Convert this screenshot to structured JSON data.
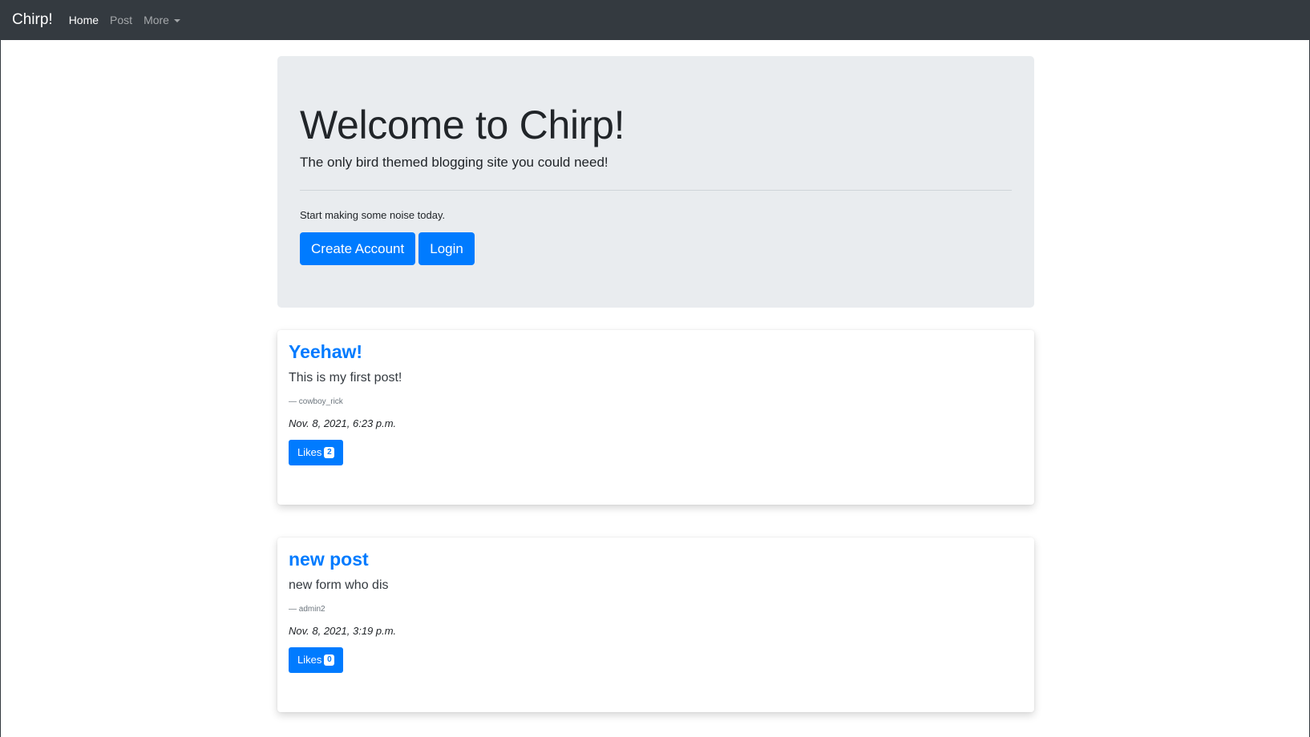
{
  "navbar": {
    "brand": "Chirp!",
    "links": [
      {
        "label": "Home",
        "active": true
      },
      {
        "label": "Post",
        "active": false
      },
      {
        "label": "More",
        "active": false,
        "dropdown": true
      }
    ]
  },
  "hero": {
    "title": "Welcome to Chirp!",
    "lead": "The only bird themed blogging site you could need!",
    "text": "Start making some noise today.",
    "create_account_label": "Create Account",
    "login_label": "Login"
  },
  "posts": [
    {
      "title": "Yeehaw!",
      "body": "This is my first post!",
      "author": "— cowboy_rick",
      "date": "Nov. 8, 2021, 6:23 p.m.",
      "likes_label": "Likes",
      "likes_count": "2"
    },
    {
      "title": "new post",
      "body": "new form who dis",
      "author": "— admin2",
      "date": "Nov. 8, 2021, 3:19 p.m.",
      "likes_label": "Likes",
      "likes_count": "0"
    }
  ],
  "colors": {
    "navbar_bg": "#343a40",
    "primary": "#007bff",
    "jumbotron_bg": "#e9ecef"
  }
}
